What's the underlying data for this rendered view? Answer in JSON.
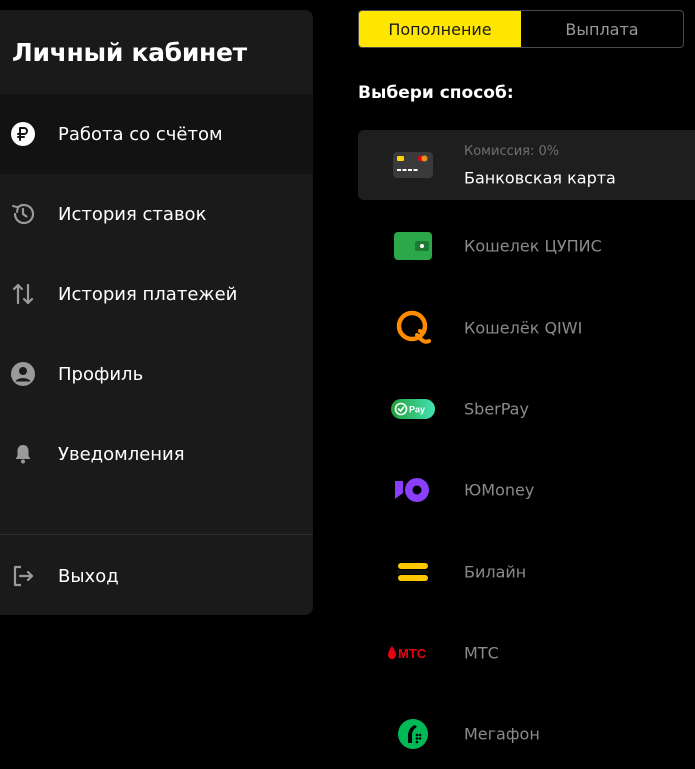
{
  "sidebar": {
    "title": "Личный кабинет",
    "items": [
      {
        "label": "Работа со счётом",
        "icon": "ruble-icon",
        "active": true
      },
      {
        "label": "История ставок",
        "icon": "history-icon"
      },
      {
        "label": "История платежей",
        "icon": "transfer-arrows-icon"
      },
      {
        "label": "Профиль",
        "icon": "user-icon"
      },
      {
        "label": "Уведомления",
        "icon": "bell-icon"
      }
    ],
    "logout_label": "Выход",
    "logout_icon": "logout-icon"
  },
  "tabs": {
    "deposit_label": "Пополнение",
    "withdraw_label": "Выплата",
    "active": "deposit"
  },
  "methods": {
    "title": "Выбери способ:",
    "items": [
      {
        "label": "Банковская карта",
        "commission": "Комиссия: 0%",
        "icon": "bank-card-icon",
        "selected": true
      },
      {
        "label": "Кошелек ЦУПИС",
        "icon": "wallet-icon"
      },
      {
        "label": "Кошелёк QIWI",
        "icon": "qiwi-logo-icon"
      },
      {
        "label": "SberPay",
        "icon": "sberpay-logo-icon",
        "icon_text": "Pay"
      },
      {
        "label": "ЮMoney",
        "icon": "yoomoney-logo-icon"
      },
      {
        "label": "Билайн",
        "icon": "beeline-logo-icon"
      },
      {
        "label": "МТС",
        "icon": "mts-logo-icon",
        "icon_text": "МТС"
      },
      {
        "label": "Мегафон",
        "icon": "megafon-logo-icon"
      }
    ]
  },
  "colors": {
    "accent": "#ffe600",
    "background": "#000000",
    "panel": "#1a1a1a",
    "selected_row": "#1e1e1e",
    "muted_text": "#8a8a8a",
    "wallet_green": "#2aa84a",
    "qiwi_orange": "#ff8c00",
    "sber_green": "#21a038",
    "yoomoney_purple": "#8b3ffd",
    "beeline_yellow": "#ffc800",
    "mts_red": "#e30611",
    "megafon_green": "#00b956"
  }
}
